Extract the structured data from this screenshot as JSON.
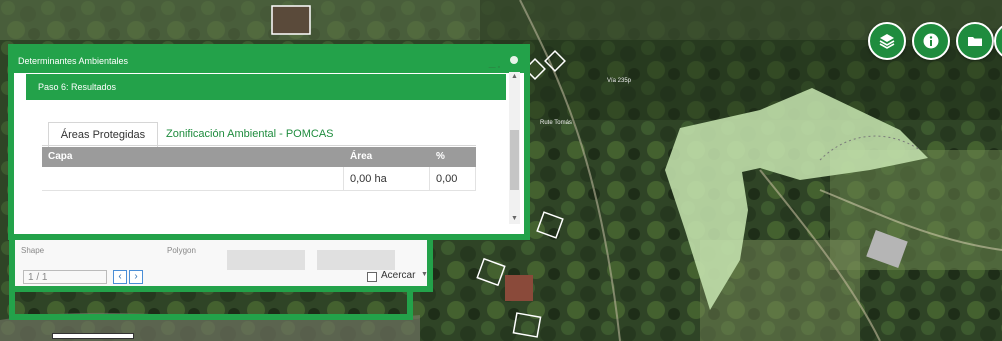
{
  "map": {
    "labels": [
      "Vía 235p",
      "Rute Tomás"
    ]
  },
  "controls": [
    {
      "name": "layers-icon"
    },
    {
      "name": "info-icon"
    },
    {
      "name": "folder-icon"
    },
    {
      "name": "settings-icon"
    }
  ],
  "panel": {
    "title": "Determinantes Ambientales",
    "step": "Paso 6: Resultados",
    "tabs": [
      {
        "label": "Áreas Protegidas",
        "active": true
      },
      {
        "label": "Zonificación Ambiental - POMCAS",
        "active": false
      }
    ],
    "table": {
      "headers": [
        "Capa",
        "Área",
        "%"
      ],
      "rows": [
        [
          "",
          "0,00 ha",
          "0,00"
        ]
      ]
    }
  },
  "sub_panel": {
    "col1": "Shape",
    "col2": "Polygon",
    "page": "1 / 1",
    "acercar_label": "Acercar"
  },
  "colors": {
    "accent": "#23a24a",
    "tab_text": "#1f8c3e",
    "header_gray": "#9b9b9b",
    "polygon_fill": "#c8e6b2"
  }
}
